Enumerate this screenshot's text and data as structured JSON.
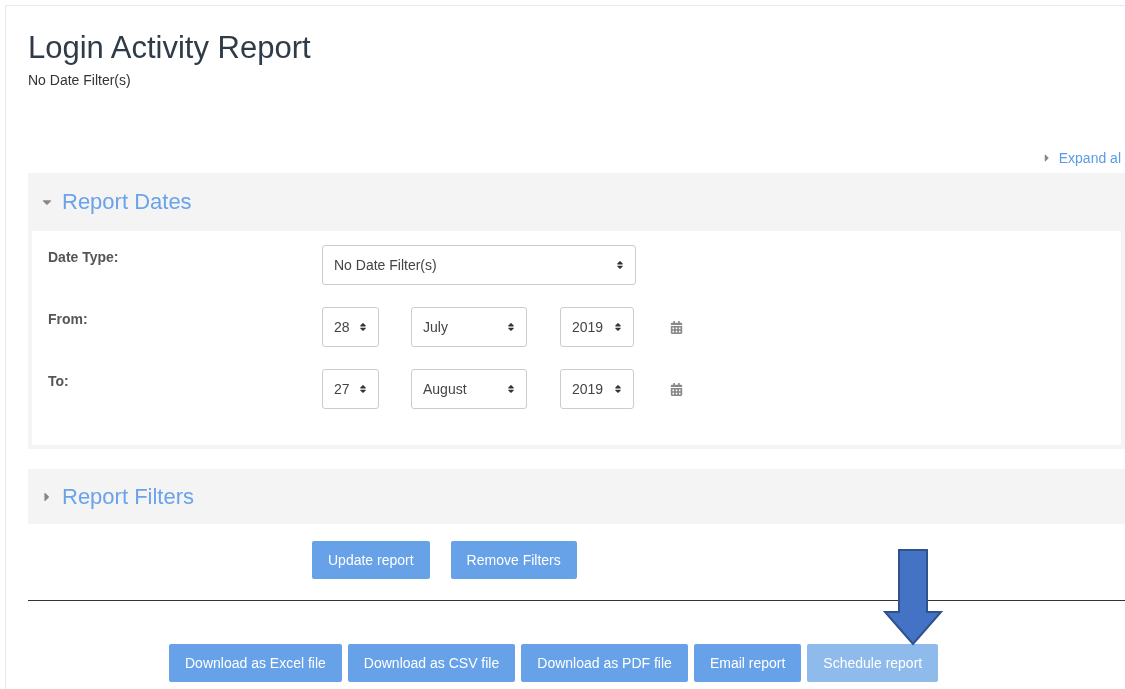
{
  "title": "Login Activity Report",
  "subtitle": "No Date Filter(s)",
  "expand_all": "Expand al",
  "sections": [
    {
      "title": "Report Dates",
      "expanded": true,
      "fields": [
        {
          "label": "Date Type:",
          "kind": "select",
          "value": "No Date Filter(s)"
        },
        {
          "label": "From:",
          "kind": "date",
          "day": "28",
          "month": "July",
          "year": "2019"
        },
        {
          "label": "To:",
          "kind": "date",
          "day": "27",
          "month": "August",
          "year": "2019"
        }
      ]
    },
    {
      "title": "Report Filters",
      "expanded": false
    }
  ],
  "form_buttons": [
    {
      "label": "Update report",
      "disabled": false
    },
    {
      "label": "Remove Filters",
      "disabled": false
    }
  ],
  "export_buttons": [
    {
      "label": "Download as Excel file",
      "disabled": false
    },
    {
      "label": "Download as CSV file",
      "disabled": false
    },
    {
      "label": "Download as PDF file",
      "disabled": false
    },
    {
      "label": "Email report",
      "disabled": false
    },
    {
      "label": "Schedule report",
      "disabled": true
    }
  ]
}
